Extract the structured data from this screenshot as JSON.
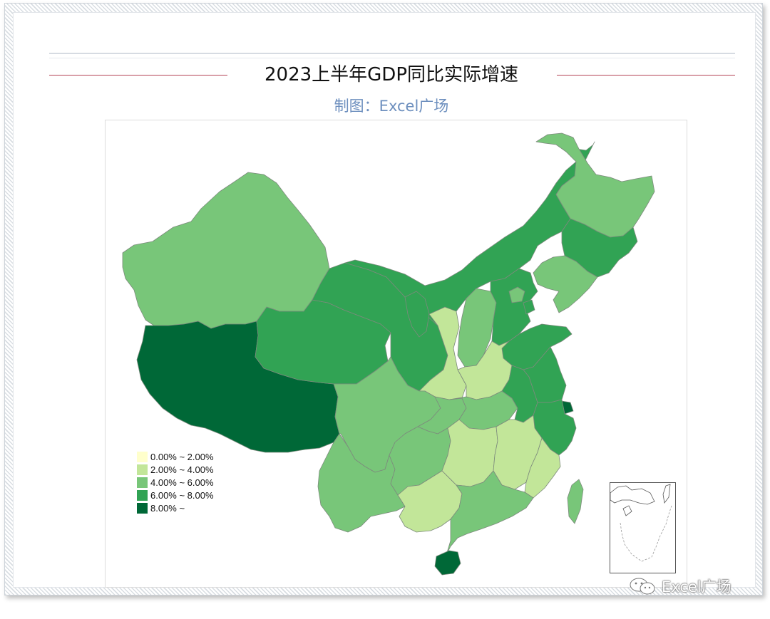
{
  "header": {
    "title": "2023上半年GDP同比实际增速",
    "subtitle": "制图：Excel广场"
  },
  "legend": [
    {
      "label": "0.00% ~ 2.00%",
      "color": "#ffffcc"
    },
    {
      "label": "2.00% ~ 4.00%",
      "color": "#c2e699"
    },
    {
      "label": "4.00% ~ 6.00%",
      "color": "#78c679"
    },
    {
      "label": "6.00% ~ 8.00%",
      "color": "#31a354"
    },
    {
      "label": "8.00% ~",
      "color": "#006837"
    }
  ],
  "regions": [
    {
      "id": "xinjiang",
      "bin": 2
    },
    {
      "id": "xizang",
      "bin": 4
    },
    {
      "id": "qinghai",
      "bin": 3
    },
    {
      "id": "gansu",
      "bin": 3
    },
    {
      "id": "neimenggu",
      "bin": 3
    },
    {
      "id": "heilongjiang",
      "bin": 2
    },
    {
      "id": "jilin",
      "bin": 3
    },
    {
      "id": "liaoning",
      "bin": 2
    },
    {
      "id": "ningxia",
      "bin": 3
    },
    {
      "id": "shaanxi",
      "bin": 1
    },
    {
      "id": "shanxi",
      "bin": 2
    },
    {
      "id": "hebei",
      "bin": 3
    },
    {
      "id": "beijing",
      "bin": 2
    },
    {
      "id": "tianjin",
      "bin": 3
    },
    {
      "id": "shandong",
      "bin": 3
    },
    {
      "id": "henan",
      "bin": 1
    },
    {
      "id": "sichuan",
      "bin": 2
    },
    {
      "id": "chongqing",
      "bin": 2
    },
    {
      "id": "hubei",
      "bin": 2
    },
    {
      "id": "anhui",
      "bin": 3
    },
    {
      "id": "jiangsu",
      "bin": 3
    },
    {
      "id": "shanghai",
      "bin": 4
    },
    {
      "id": "zhejiang",
      "bin": 3
    },
    {
      "id": "yunnan",
      "bin": 2
    },
    {
      "id": "guizhou",
      "bin": 2
    },
    {
      "id": "hunan",
      "bin": 1
    },
    {
      "id": "jiangxi",
      "bin": 1
    },
    {
      "id": "fujian",
      "bin": 1
    },
    {
      "id": "guangxi",
      "bin": 1
    },
    {
      "id": "guangdong",
      "bin": 2
    },
    {
      "id": "hainan",
      "bin": 4
    },
    {
      "id": "taiwan",
      "bin": 2
    }
  ],
  "watermark": {
    "text": "Excel广场",
    "icon": "wechat-icon"
  }
}
